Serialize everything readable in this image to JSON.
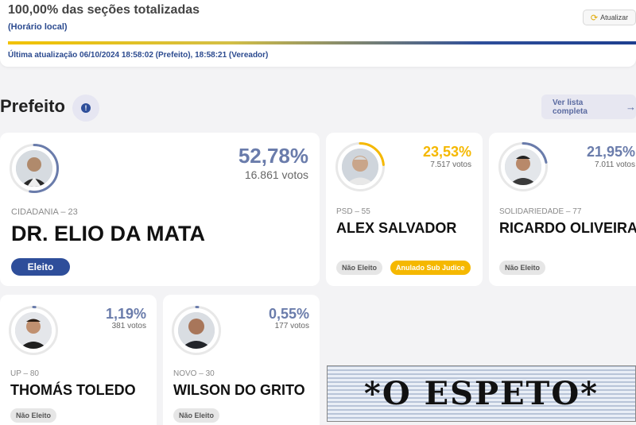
{
  "status": {
    "title": "100,00% das seções totalizadas",
    "local_time": "(Horário local)",
    "progress_percent": 100,
    "last_update": "Última atualização 06/10/2024 18:58:02 (Prefeito), 18:58:21 (Vereador)",
    "refresh_label": "Atualizar",
    "refresh_icon": "refresh-icon"
  },
  "section": {
    "title": "Prefeito",
    "info_icon": "!",
    "full_list_label": "Ver lista completa",
    "full_list_arrow": "→"
  },
  "candidates": [
    {
      "name": "DR. ELIO DA MATA",
      "party": "CIDADANIA – 23",
      "percent": "52,78%",
      "votes": "16.861 votos",
      "badges": [
        "Eleito"
      ],
      "arc_color": "#6a7cab",
      "share": 0.5278
    },
    {
      "name": "ALEX SALVADOR",
      "party": "PSD – 55",
      "percent": "23,53%",
      "votes": "7.517 votos",
      "badges": [
        "Não Eleito",
        "Anulado Sub Judice"
      ],
      "arc_color": "#f5b800",
      "share": 0.2353
    },
    {
      "name": "RICARDO OLIVEIRA",
      "party": "SOLIDARIEDADE – 77",
      "percent": "21,95%",
      "votes": "7.011 votos",
      "badges": [
        "Não Eleito"
      ],
      "arc_color": "#6a7cab",
      "share": 0.2195
    },
    {
      "name": "THOMÁS TOLEDO",
      "party": "UP – 80",
      "percent": "1,19%",
      "votes": "381 votos",
      "badges": [
        "Não Eleito"
      ],
      "arc_color": "#6a7cab",
      "share": 0.0119
    },
    {
      "name": "WILSON DO GRITO",
      "party": "NOVO – 30",
      "percent": "0,55%",
      "votes": "177 votos",
      "badges": [
        "Não Eleito"
      ],
      "arc_color": "#6a7cab",
      "share": 0.0055
    }
  ],
  "colors": {
    "accent_blue": "#2e4e9a",
    "percent_blue": "#6a7cab",
    "percent_yellow": "#f5b800"
  },
  "logo": {
    "text": "*O ESPETO*"
  }
}
